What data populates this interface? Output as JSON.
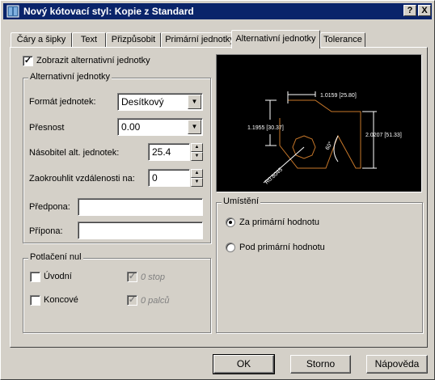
{
  "window": {
    "title": "Nový kótovací styl: Kopie z Standard",
    "help_label": "?",
    "close_label": "X"
  },
  "tabs": [
    {
      "label": "Čáry a šipky"
    },
    {
      "label": "Text"
    },
    {
      "label": "Přizpůsobit"
    },
    {
      "label": "Primární jednotky"
    },
    {
      "label": "Alternativní jednotky",
      "active": true
    },
    {
      "label": "Tolerance"
    }
  ],
  "show_alt": {
    "label": "Zobrazit alternativní jednotky",
    "checked": true,
    "mark": "✓"
  },
  "alt_units": {
    "title": "Alternativní jednotky",
    "format_label": "Formát jednotek:",
    "format_value": "Desítkový",
    "precision_label": "Přesnost",
    "precision_value": "0.00",
    "multiplier_label": "Násobitel alt. jednotek:",
    "multiplier_value": "25.4",
    "round_label": "Zaokrouhlit vzdálenosti  na:",
    "round_value": "0",
    "prefix_label": "Předpona:",
    "prefix_value": "",
    "suffix_label": "Přípona:",
    "suffix_value": ""
  },
  "zero_suppression": {
    "title": "Potlačení nul",
    "leading_label": "Úvodní",
    "trailing_label": "Koncové",
    "feet_label": "0 stop",
    "inches_label": "0 palců",
    "check_mark": "✓"
  },
  "preview": {
    "dim_top": "1.0159 [25.80]",
    "dim_left": "1.1955 [30.37]",
    "dim_right": "2.0207 [51.33]",
    "dim_angle": "60°",
    "dim_radius": "R0.8045"
  },
  "placement": {
    "title": "Umístění",
    "below_primary": "Za primární hodnotu",
    "below_selected": true,
    "under_primary": "Pod primární hodnotu"
  },
  "buttons": {
    "ok": "OK",
    "cancel": "Storno",
    "help": "Nápověda"
  },
  "colors": {
    "titlebar": "#0a246a",
    "dialog_bg": "#d4d0c8",
    "preview_bg": "#000000",
    "geometry": "#c8782a",
    "dim_lines": "#ffffff"
  }
}
